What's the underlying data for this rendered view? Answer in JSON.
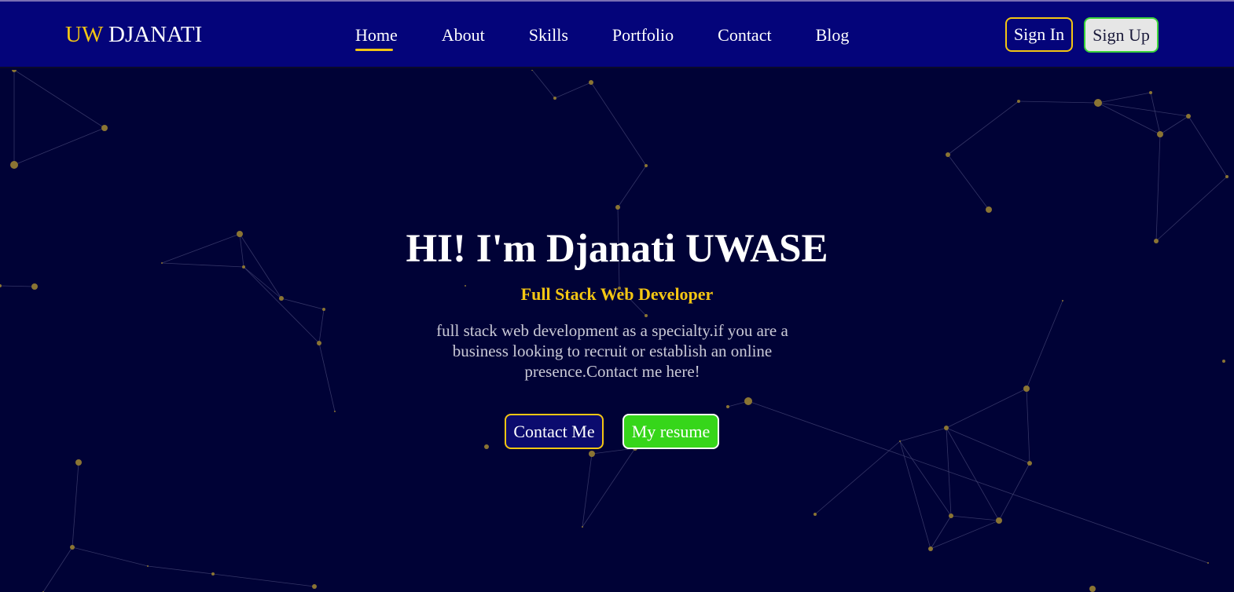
{
  "header": {
    "logo_accent": "UW",
    "logo_name": "DJANATI",
    "nav": [
      {
        "label": "Home",
        "active": true
      },
      {
        "label": "About"
      },
      {
        "label": "Skills"
      },
      {
        "label": "Portfolio"
      },
      {
        "label": "Contact"
      },
      {
        "label": "Blog"
      }
    ],
    "sign_in": "Sign In",
    "sign_up": "Sign Up"
  },
  "hero": {
    "title": "HI! I'm Djanati UWASE",
    "subtitle": "Full Stack Web Developer",
    "description": "full stack web development as a specialty.if you are a business looking to recruit or establish an online presence.Contact me here!",
    "contact_button": "Contact Me",
    "resume_button": "My resume"
  },
  "colors": {
    "header_bg": "#04047a",
    "page_bg": "#000236",
    "accent_yellow": "#f4c613",
    "resume_green": "#36d61a",
    "particle": "#8a7433"
  }
}
